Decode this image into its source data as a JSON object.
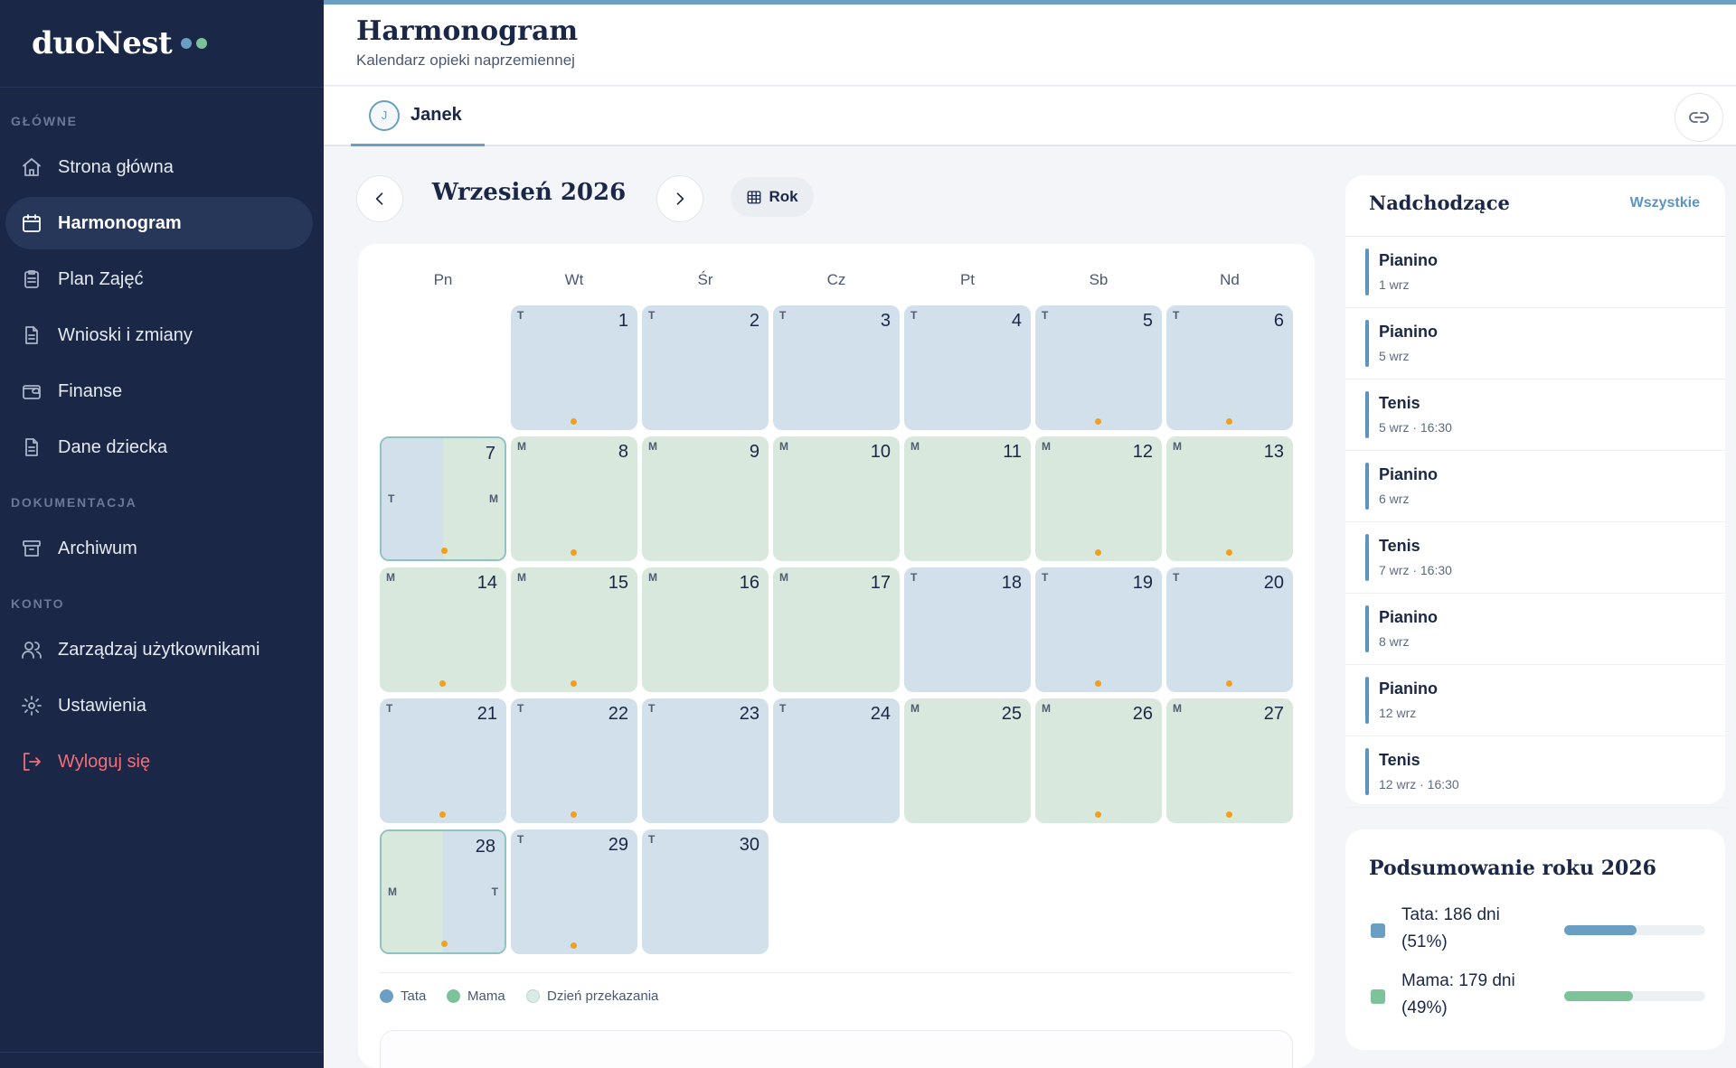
{
  "brand": {
    "name": "duoNest",
    "dot_colors": [
      "#6a9ec2",
      "#7cc39a"
    ]
  },
  "sidebar": {
    "sections": [
      {
        "label": "GŁÓWNE"
      },
      {
        "label": "DOKUMENTACJA"
      },
      {
        "label": "KONTO"
      }
    ],
    "items": [
      {
        "label": "Strona główna",
        "icon": "home-icon"
      },
      {
        "label": "Harmonogram",
        "icon": "calendar-icon",
        "active": true
      },
      {
        "label": "Plan Zajęć",
        "icon": "clipboard-icon"
      },
      {
        "label": "Wnioski i zmiany",
        "icon": "document-icon"
      },
      {
        "label": "Finanse",
        "icon": "wallet-icon"
      },
      {
        "label": "Dane dziecka",
        "icon": "document-icon"
      },
      {
        "label": "Archiwum",
        "icon": "archive-icon"
      },
      {
        "label": "Zarządzaj użytkownikami",
        "icon": "users-icon"
      },
      {
        "label": "Ustawienia",
        "icon": "gear-icon"
      },
      {
        "label": "Wyloguj się",
        "icon": "logout-icon"
      }
    ]
  },
  "header": {
    "title": "Harmonogram",
    "subtitle": "Kalendarz opieki naprzemiennej"
  },
  "child_tab": {
    "initial": "J",
    "name": "Janek"
  },
  "calendar": {
    "month_label": "Wrzesień 2026",
    "year_button": "Rok",
    "weekdays": [
      "Pn",
      "Wt",
      "Śr",
      "Cz",
      "Pt",
      "Sb",
      "Nd"
    ],
    "first_weekday_index": 1,
    "days": [
      {
        "day": "1",
        "who": "T",
        "event": true
      },
      {
        "day": "2",
        "who": "T",
        "event": false
      },
      {
        "day": "3",
        "who": "T",
        "event": false
      },
      {
        "day": "4",
        "who": "T",
        "event": false
      },
      {
        "day": "5",
        "who": "T",
        "event": true
      },
      {
        "day": "6",
        "who": "T",
        "event": true
      },
      {
        "day": "7",
        "who": "handover",
        "from": "T",
        "to": "M",
        "event": true
      },
      {
        "day": "8",
        "who": "M",
        "event": true
      },
      {
        "day": "9",
        "who": "M",
        "event": false
      },
      {
        "day": "10",
        "who": "M",
        "event": false
      },
      {
        "day": "11",
        "who": "M",
        "event": false
      },
      {
        "day": "12",
        "who": "M",
        "event": true
      },
      {
        "day": "13",
        "who": "M",
        "event": true
      },
      {
        "day": "14",
        "who": "M",
        "event": true
      },
      {
        "day": "15",
        "who": "M",
        "event": true
      },
      {
        "day": "16",
        "who": "M",
        "event": false
      },
      {
        "day": "17",
        "who": "M",
        "event": false
      },
      {
        "day": "18",
        "who": "T",
        "event": false
      },
      {
        "day": "19",
        "who": "T",
        "event": true
      },
      {
        "day": "20",
        "who": "T",
        "event": true
      },
      {
        "day": "21",
        "who": "T",
        "event": true
      },
      {
        "day": "22",
        "who": "T",
        "event": true
      },
      {
        "day": "23",
        "who": "T",
        "event": false
      },
      {
        "day": "24",
        "who": "T",
        "event": false
      },
      {
        "day": "25",
        "who": "M",
        "event": false
      },
      {
        "day": "26",
        "who": "M",
        "event": true
      },
      {
        "day": "27",
        "who": "M",
        "event": true
      },
      {
        "day": "28",
        "who": "handover",
        "from": "M",
        "to": "T",
        "event": true
      },
      {
        "day": "29",
        "who": "T",
        "event": true
      },
      {
        "day": "30",
        "who": "T",
        "event": false
      }
    ],
    "legend": [
      {
        "label": "Tata",
        "color": "#6a9ec2"
      },
      {
        "label": "Mama",
        "color": "#7cc39a"
      },
      {
        "label": "Dzień przekazania",
        "color": "#d9ece8"
      }
    ]
  },
  "upcoming": {
    "title": "Nadchodzące",
    "all_link": "Wszystkie",
    "events": [
      {
        "name": "Pianino",
        "date": "1 wrz"
      },
      {
        "name": "Pianino",
        "date": "5 wrz"
      },
      {
        "name": "Tenis",
        "date": "5 wrz · 16:30"
      },
      {
        "name": "Pianino",
        "date": "6 wrz"
      },
      {
        "name": "Tenis",
        "date": "7 wrz · 16:30"
      },
      {
        "name": "Pianino",
        "date": "8 wrz"
      },
      {
        "name": "Pianino",
        "date": "12 wrz"
      },
      {
        "name": "Tenis",
        "date": "12 wrz · 16:30"
      }
    ]
  },
  "summary": {
    "title": "Podsumowanie roku 2026",
    "rows": [
      {
        "label": "Tata: 186 dni (51%)",
        "fraction": 0.51,
        "color": "#6a9ec2"
      },
      {
        "label": "Mama: 179 dni (49%)",
        "fraction": 0.49,
        "color": "#7cc39a"
      }
    ]
  },
  "colors": {
    "sidebar_bg": "#1a2746",
    "accent": "#6a9ec2",
    "tata_day": "#d1e0ea",
    "mama_day": "#d8e8dc",
    "event_dot": "#f0a020",
    "logout": "#ef6f7a"
  }
}
